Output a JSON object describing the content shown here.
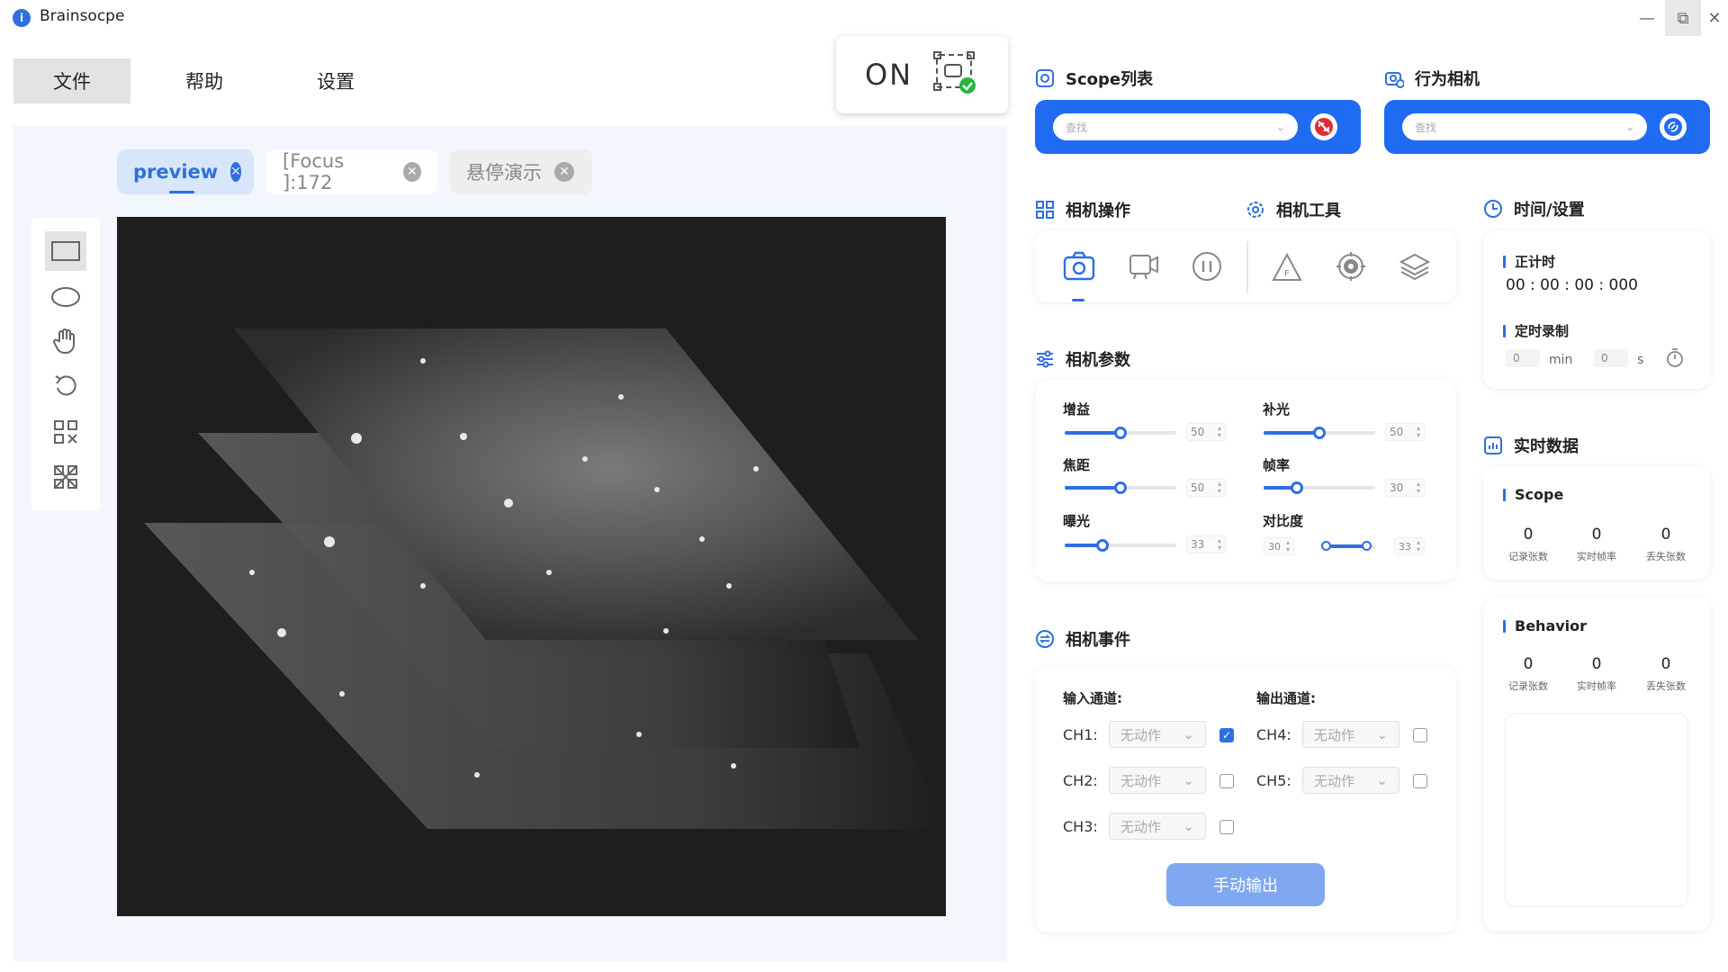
{
  "app": {
    "title": "Brainsocpe",
    "icon": "app-logo-icon"
  },
  "window_controls": {
    "minimize": "—",
    "restore": "⧉",
    "close": "✕"
  },
  "menu": {
    "file": "文件",
    "help": "帮助",
    "settings": "设置"
  },
  "connection": {
    "state": "ON",
    "icon": "camera-connected-icon"
  },
  "tabs": [
    {
      "label": "preview",
      "active": true
    },
    {
      "label": "[Focus ]:172",
      "active": false
    },
    {
      "label": "悬停演示",
      "active": false
    }
  ],
  "tools": [
    "rectangle-tool-icon",
    "ellipse-tool-icon",
    "hand-tool-icon",
    "undo-icon",
    "grid-select-icon",
    "grid-clear-icon"
  ],
  "scope_list": {
    "title": "Scope列表",
    "search_placeholder": "查找"
  },
  "behavior_camera": {
    "title": "行为相机",
    "search_placeholder": "查找"
  },
  "camera_ops": {
    "title": "相机操作"
  },
  "camera_tools": {
    "title": "相机工具"
  },
  "time_settings": {
    "title": "时间/设置",
    "timer_label": "正计时",
    "timer_value": "00 : 00 : 00 : 000",
    "record_label": "定时录制",
    "min_value": "0",
    "min_unit": "min",
    "sec_value": "0",
    "sec_unit": "s"
  },
  "camera_params": {
    "title": "相机参数",
    "gain": {
      "label": "增益",
      "value": "50",
      "level": 0.5
    },
    "fill_light": {
      "label": "补光",
      "value": "50",
      "level": 0.5
    },
    "focus": {
      "label": "焦距",
      "value": "50",
      "level": 0.5
    },
    "frame_rate": {
      "label": "帧率",
      "value": "30",
      "level": 0.3
    },
    "exposure": {
      "label": "曝光",
      "value": "33",
      "level": 0.33
    },
    "contrast": {
      "label": "对比度",
      "min_value": "30",
      "max_value": "33"
    }
  },
  "realtime": {
    "title": "实时数据",
    "scope": {
      "label": "Scope",
      "recorded": "0",
      "fps": "0",
      "lost": "0"
    },
    "behavior": {
      "label": "Behavior",
      "recorded": "0",
      "fps": "0",
      "lost": "0"
    },
    "stat_labels": {
      "recorded": "记录张数",
      "fps": "实时帧率",
      "lost": "丢失张数"
    }
  },
  "camera_events": {
    "title": "相机事件",
    "input_label": "输入通道:",
    "output_label": "输出通道:",
    "channels": [
      {
        "name": "CH1:",
        "action": "无动作",
        "checked": true
      },
      {
        "name": "CH2:",
        "action": "无动作",
        "checked": false
      },
      {
        "name": "CH3:",
        "action": "无动作",
        "checked": false
      },
      {
        "name": "CH4:",
        "action": "无动作",
        "checked": false
      },
      {
        "name": "CH5:",
        "action": "无动作",
        "checked": false
      }
    ],
    "manual_output": "手动输出"
  },
  "colors": {
    "accent": "#2f6fe0",
    "blue_bar": "#1f6bf2",
    "canvas_bg": "#1e1e1e"
  }
}
